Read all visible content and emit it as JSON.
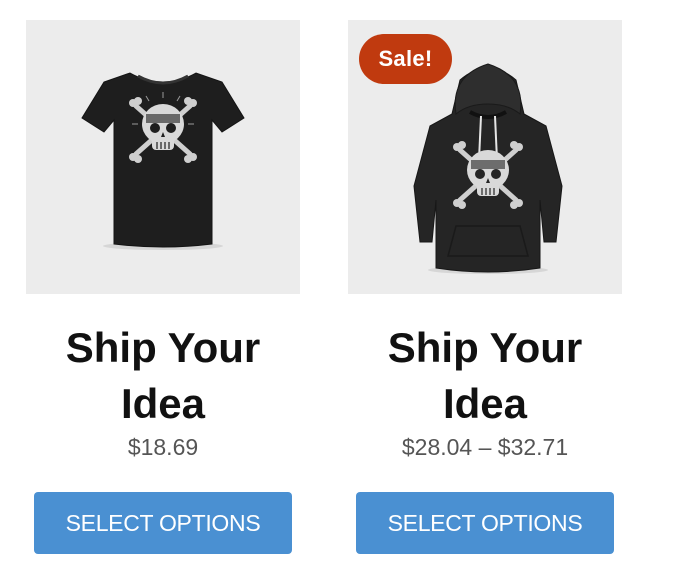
{
  "products": [
    {
      "title_line1": "Ship Your",
      "title_line2": "Idea",
      "price": "$18.69",
      "button_label": "SELECT OPTIONS",
      "image_icon": "tshirt-icon"
    },
    {
      "badge": "Sale!",
      "title_line1": "Ship Your",
      "title_line2": "Idea",
      "price": "$28.04 – $32.71",
      "button_label": "SELECT OPTIONS",
      "image_icon": "hoodie-icon"
    }
  ],
  "colors": {
    "image_background": "#ececec",
    "sale_badge": "#c03a0f",
    "button": "#4a90d2",
    "title_text": "#111111",
    "price_text": "#555555"
  }
}
